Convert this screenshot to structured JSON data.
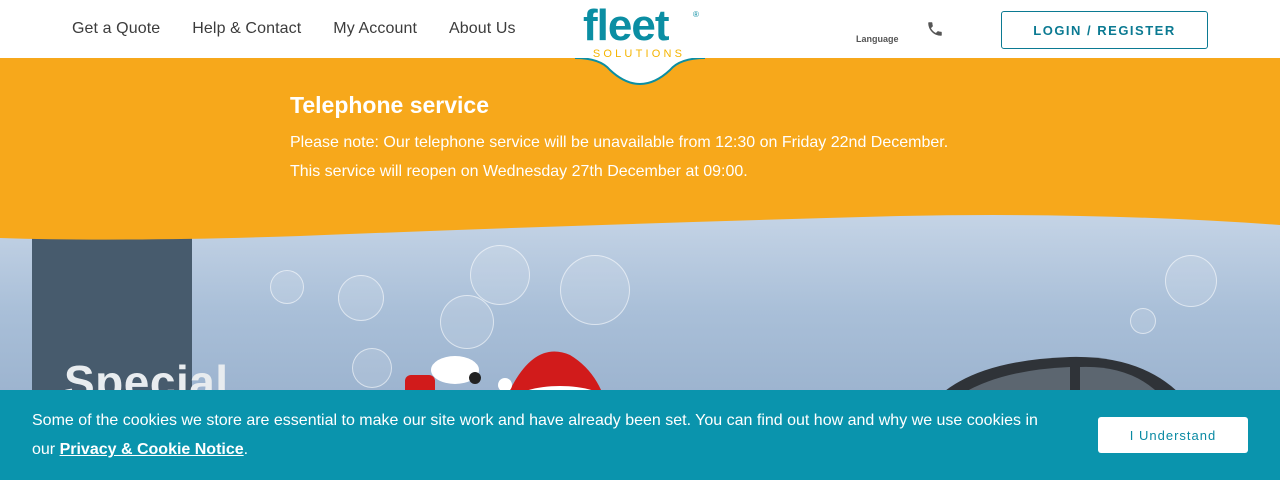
{
  "header": {
    "nav": [
      "Get a Quote",
      "Help & Contact",
      "My Account",
      "About Us"
    ],
    "logo_word": "fleet",
    "logo_sub": "SOLUTIONS",
    "language_label": "Language",
    "login_label": "LOGIN / REGISTER"
  },
  "banner": {
    "title": "Telephone service",
    "text": "Please note: Our telephone service will be unavailable from 12:30 on Friday 22nd December. This service will reopen on Wednesday 27th December at 09:00."
  },
  "hero": {
    "heading": "Special"
  },
  "cookie": {
    "text_before": "Some of the cookies we store are essential to make our site work and have already been set. You can find out how and why we use cookies in our ",
    "link": "Privacy & Cookie Notice",
    "text_after": ".",
    "button": "I Understand"
  },
  "colors": {
    "brand_teal": "#0b8ea3",
    "brand_yellow": "#f5b400",
    "banner_orange": "#f7a81b",
    "cookie_bg": "#0a94ad",
    "hero_panel": "#475b6d"
  },
  "icons": [
    "phone-icon",
    "logo-mark"
  ]
}
